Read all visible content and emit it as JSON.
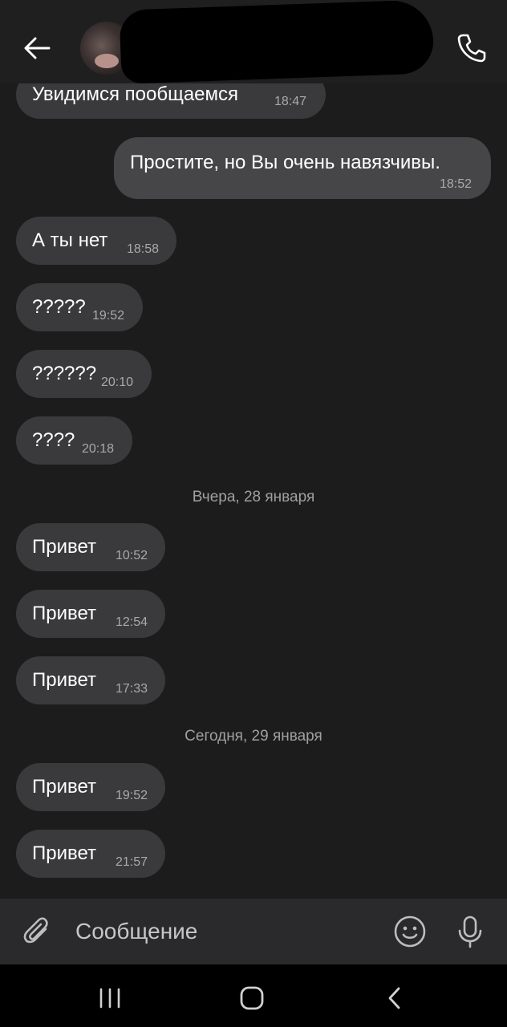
{
  "messages": [
    {
      "text": "Увидимся пообщаемся",
      "time": "18:47",
      "direction": "in"
    },
    {
      "text": "Простите, но Вы очень навязчивы.",
      "time": "18:52",
      "direction": "out"
    },
    {
      "text": "А ты нет",
      "time": "18:58",
      "direction": "in"
    },
    {
      "text": "?????",
      "time": "19:52",
      "direction": "in"
    },
    {
      "text": "??????",
      "time": "20:10",
      "direction": "in"
    },
    {
      "text": "????",
      "time": "20:18",
      "direction": "in"
    },
    {
      "text": "Привет",
      "time": "10:52",
      "direction": "in"
    },
    {
      "text": "Привет",
      "time": "12:54",
      "direction": "in"
    },
    {
      "text": "Привет",
      "time": "17:33",
      "direction": "in"
    },
    {
      "text": "Привет",
      "time": "19:52",
      "direction": "in"
    },
    {
      "text": "Привет",
      "time": "21:57",
      "direction": "in"
    }
  ],
  "date_separators": [
    "Вчера, 28 января",
    "Сегодня, 29 января"
  ],
  "composer": {
    "placeholder": "Сообщение"
  },
  "icons": {
    "back": "arrow-left-icon",
    "call": "phone-icon",
    "attach": "paperclip-icon",
    "emoji": "smiley-icon",
    "mic": "microphone-icon",
    "nav_recents": "recents-icon",
    "nav_home": "home-icon",
    "nav_back": "nav-back-icon"
  },
  "colors": {
    "background": "#1c1c1d",
    "incoming_bubble": "#3a3a3c",
    "outgoing_bubble": "#464648",
    "timestamp": "#a9a9ad"
  }
}
